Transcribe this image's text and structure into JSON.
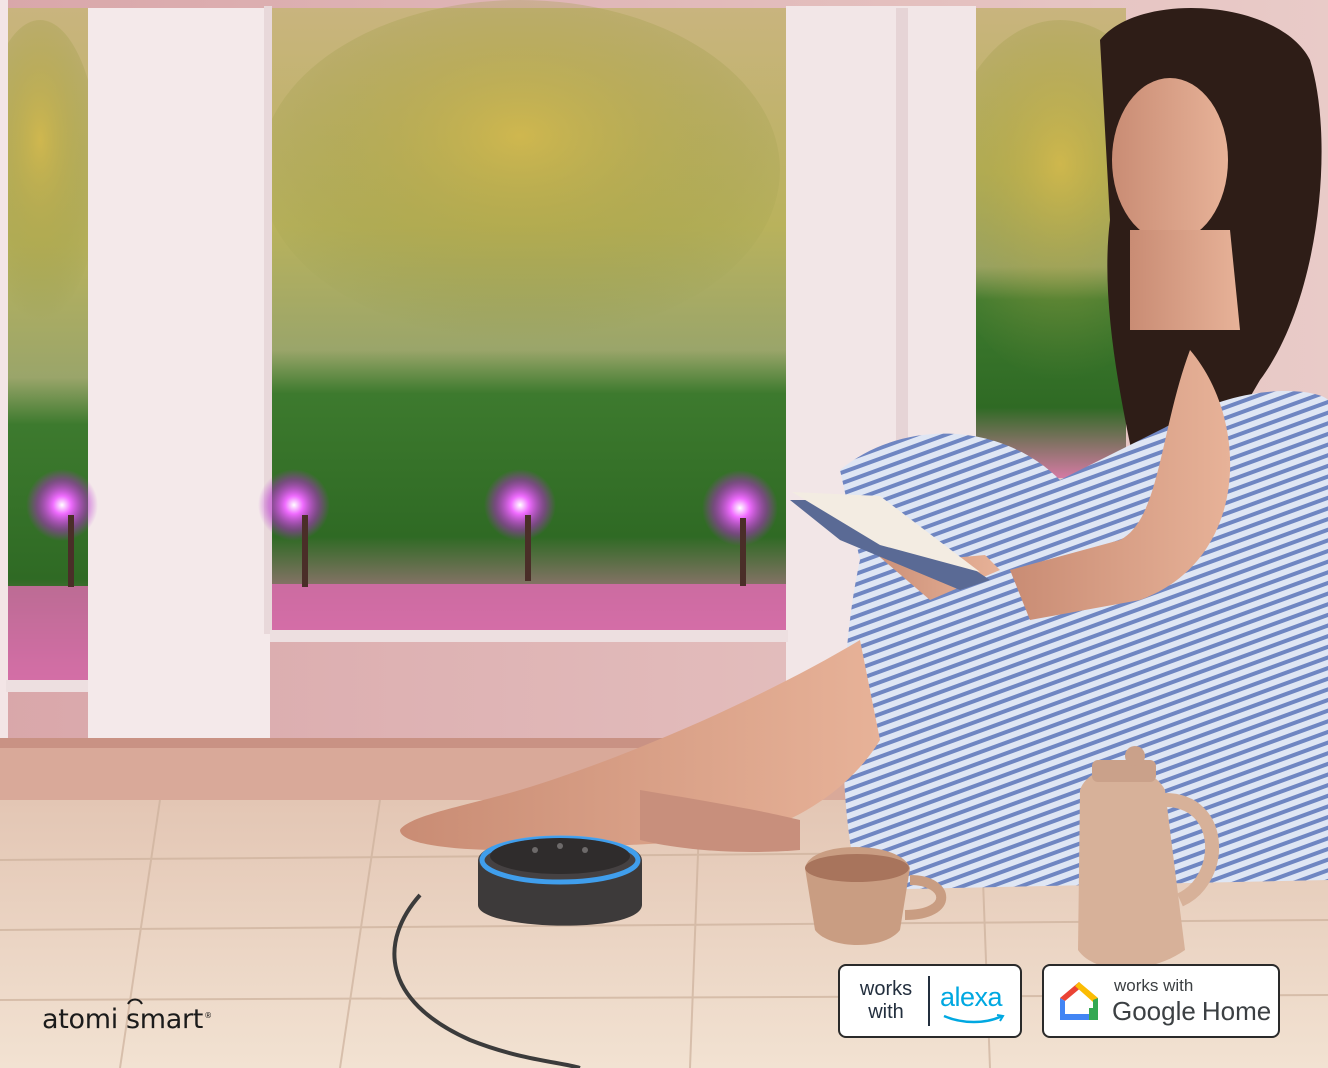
{
  "brand": {
    "word1": "atomi",
    "word2": "smart",
    "registered": "®"
  },
  "badges": {
    "alexa": {
      "line1": "works",
      "line2": "with",
      "brand": "alexa",
      "color": "#00a8e1"
    },
    "google_home": {
      "works_with": "works with",
      "google": "Google",
      "home": "Home"
    }
  },
  "colors": {
    "light_glow": "#e040fb",
    "echo_ring": "#3fa9ff"
  }
}
